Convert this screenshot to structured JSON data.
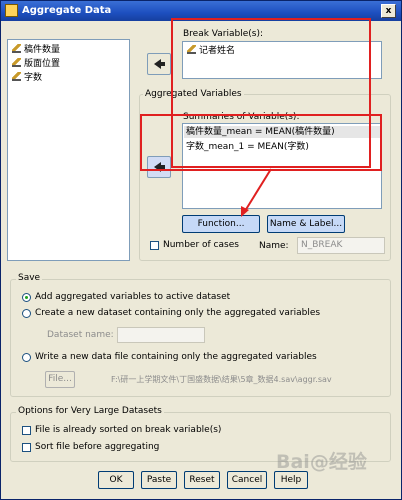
{
  "window": {
    "title": "Aggregate Data",
    "close_glyph": "x"
  },
  "source_list": {
    "items": [
      "稿件数量",
      "版面位置",
      "字数"
    ]
  },
  "break_variables": {
    "label": "Break Variable(s):",
    "items": [
      "记者姓名"
    ]
  },
  "aggregated": {
    "group_label": "Aggregated Variables",
    "summaries_label": "Summaries of Variable(s):",
    "items": [
      "稿件数量_mean = MEAN(稿件数量)",
      "字数_mean_1 = MEAN(字数)"
    ],
    "function_button": "Function...",
    "name_label_button": "Name & Label...",
    "number_of_cases_label": "Number of cases",
    "name_label": "Name:",
    "name_value": "N_BREAK"
  },
  "save": {
    "group_label": "Save",
    "option_add": "Add aggregated variables to active dataset",
    "option_create": "Create a new dataset containing only the aggregated variables",
    "dataset_name_label": "Dataset name:",
    "option_write": "Write a new data file containing only the aggregated variables",
    "file_button": "File...",
    "file_path": "F:\\研一上学期文件\\丁国盛数据\\结果\\5章_数据4.sav\\aggr.sav"
  },
  "large": {
    "group_label": "Options for Very Large Datasets",
    "sorted_label": "File is already sorted on break variable(s)",
    "sort_before_label": "Sort file before aggregating"
  },
  "buttons": {
    "ok": "OK",
    "paste": "Paste",
    "reset": "Reset",
    "cancel": "Cancel",
    "help": "Help"
  },
  "watermark": "Bai@经验",
  "colors": {
    "annotation_red": "#e02020",
    "title_blue": "#1d4fbf"
  }
}
